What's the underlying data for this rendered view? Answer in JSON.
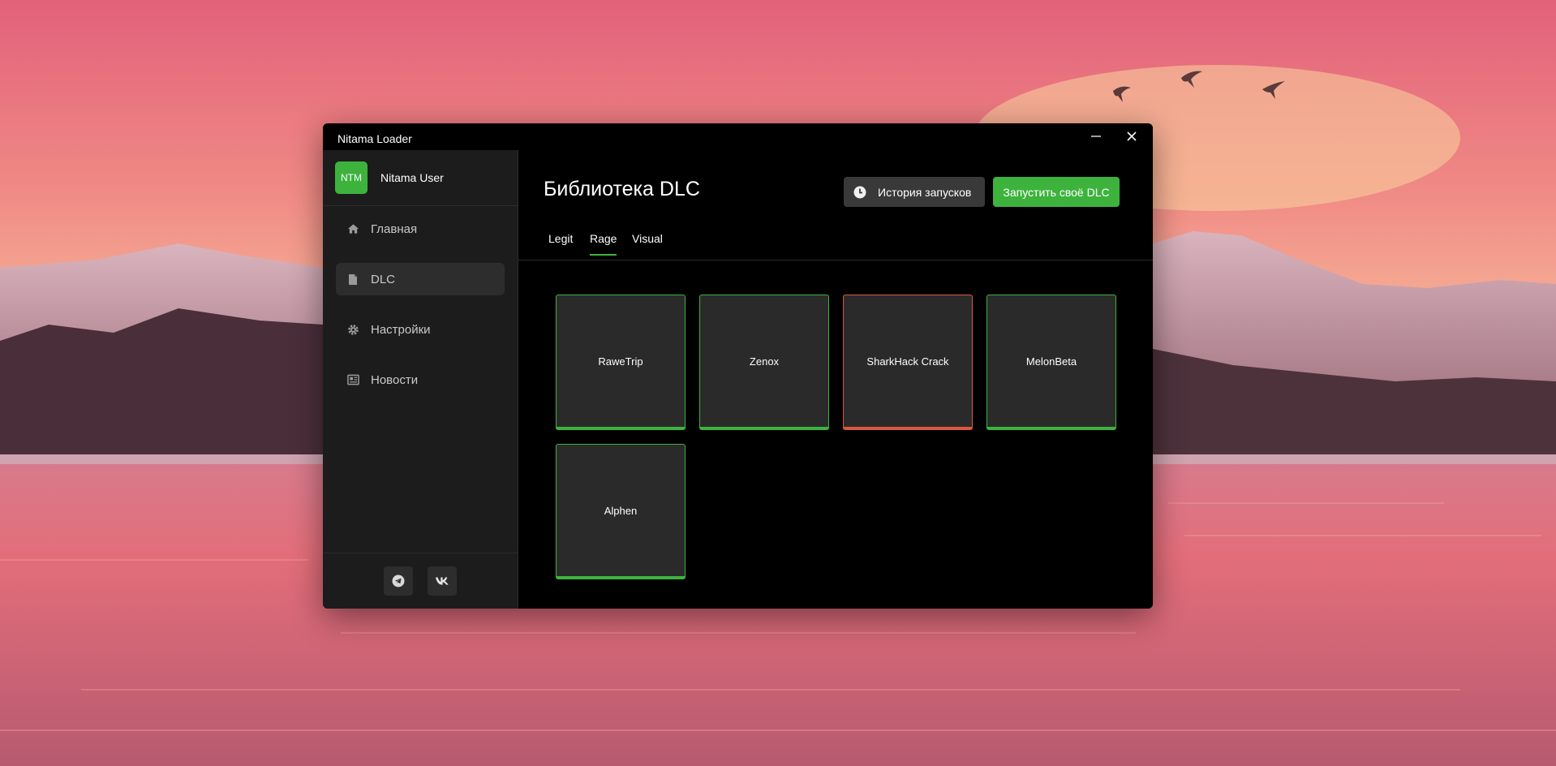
{
  "window": {
    "title": "Nitama Loader"
  },
  "user": {
    "avatar_text": "NTM",
    "name": "Nitama User"
  },
  "sidebar": {
    "items": [
      {
        "label": "Главная",
        "icon": "home-icon"
      },
      {
        "label": "DLC",
        "icon": "file-icon",
        "active": true
      },
      {
        "label": "Настройки",
        "icon": "gear-icon"
      },
      {
        "label": "Новости",
        "icon": "news-icon"
      }
    ],
    "footer": [
      {
        "icon": "telegram-icon"
      },
      {
        "icon": "vk-icon"
      }
    ]
  },
  "main": {
    "title": "Библиотека DLC",
    "history_button": "История запусков",
    "launch_button": "Запустить своё DLC",
    "tabs": [
      {
        "label": "Legit"
      },
      {
        "label": "Rage",
        "active": true
      },
      {
        "label": "Visual"
      }
    ],
    "cards": [
      {
        "label": "RaweTrip",
        "status": "ok"
      },
      {
        "label": "Zenox",
        "status": "ok"
      },
      {
        "label": "SharkHack Crack",
        "status": "bad"
      },
      {
        "label": "MelonBeta",
        "status": "ok"
      },
      {
        "label": "Alphen",
        "status": "ok"
      }
    ]
  },
  "colors": {
    "accent": "#3db33d",
    "danger": "#d85a3c",
    "sidebar_bg": "#1c1c1c",
    "card_bg": "#2a2a2a"
  }
}
